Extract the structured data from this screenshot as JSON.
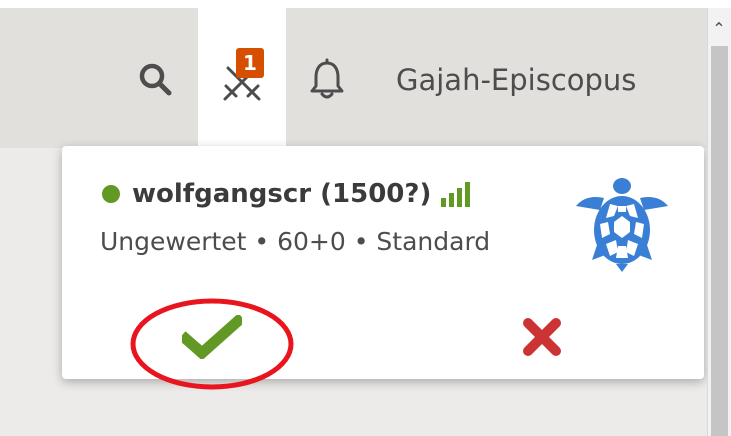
{
  "header": {
    "notification_count": "1",
    "username": "Gajah-Episcopus",
    "icons": [
      "search-icon",
      "crossed-swords-icon",
      "bell-icon"
    ]
  },
  "challenge": {
    "challenger": "wolfgangscr (1500?)",
    "details": "Ungewertet • 60+0 • Standard",
    "online_color": "#629924",
    "icons": [
      "signal-bars-icon",
      "turtle-icon",
      "checkmark-icon",
      "cross-icon"
    ]
  },
  "colors": {
    "accent": "#629924",
    "badge": "#d64f00",
    "decline": "#cc3333",
    "turtle": "#3a7fd6",
    "highlight": "#e8141e"
  }
}
